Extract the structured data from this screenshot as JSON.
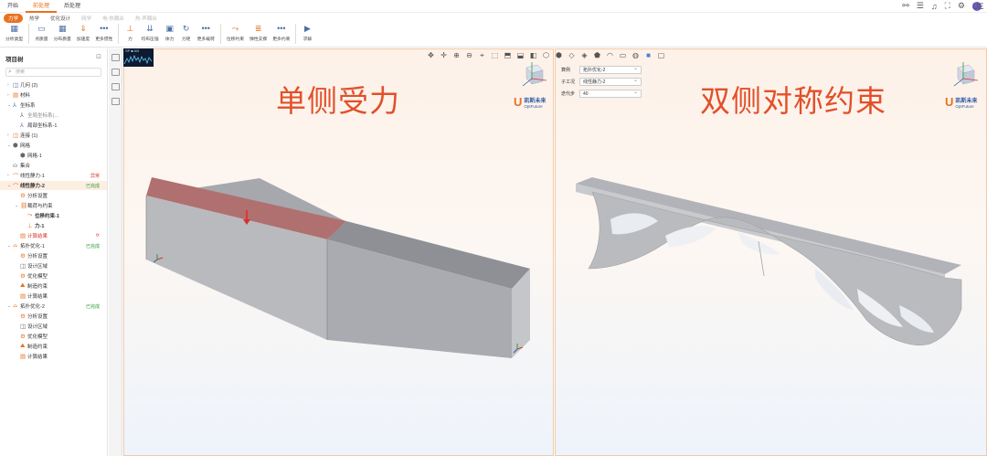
{
  "menu": [
    {
      "label": "开始",
      "active": false
    },
    {
      "label": "前处理",
      "active": true
    },
    {
      "label": "后处理",
      "active": false
    }
  ],
  "subtabs": [
    {
      "label": "力学",
      "state": "active"
    },
    {
      "label": "热学",
      "state": "normal"
    },
    {
      "label": "优化设计",
      "state": "normal"
    },
    {
      "label": "网学",
      "state": "disabled"
    },
    {
      "label": "电-热耦合",
      "state": "disabled"
    },
    {
      "label": "热-声耦合",
      "state": "disabled"
    }
  ],
  "toolbar": [
    {
      "label": "分析类型",
      "icon": "analysis-type-icon",
      "glyph": "▦"
    },
    {
      "sep": true
    },
    {
      "label": "点质量",
      "icon": "point-mass-icon",
      "glyph": "▭"
    },
    {
      "label": "分布质量",
      "icon": "distributed-mass-icon",
      "glyph": "▦"
    },
    {
      "label": "加速度",
      "icon": "acceleration-icon",
      "glyph": "⇓"
    },
    {
      "label": "更多惯性",
      "icon": "more-inertia-icon",
      "glyph": "•••"
    },
    {
      "sep": true
    },
    {
      "label": "力",
      "icon": "force-icon",
      "glyph": "⊥"
    },
    {
      "label": "均布压强",
      "icon": "pressure-icon",
      "glyph": "⇊"
    },
    {
      "label": "体力",
      "icon": "body-force-icon",
      "glyph": "▣"
    },
    {
      "label": "力矩",
      "icon": "moment-icon",
      "glyph": "↻"
    },
    {
      "label": "更多载荷",
      "icon": "more-loads-icon",
      "glyph": "•••"
    },
    {
      "sep": true
    },
    {
      "label": "位移约束",
      "icon": "displacement-icon",
      "glyph": "⤳"
    },
    {
      "label": "弹性支撑",
      "icon": "elastic-support-icon",
      "glyph": "≣"
    },
    {
      "label": "更多约束",
      "icon": "more-constraints-icon",
      "glyph": "•••"
    },
    {
      "sep": true
    },
    {
      "label": "求解",
      "icon": "solve-icon",
      "glyph": "▶"
    }
  ],
  "panel": {
    "title": "项目树",
    "search_placeholder": "搜索"
  },
  "tree": [
    {
      "depth": 0,
      "arrow": "›",
      "icon": "◫",
      "ic": "b",
      "text": "几何 (2)"
    },
    {
      "depth": 0,
      "arrow": "›",
      "icon": "▤",
      "ic": "o",
      "text": "材料"
    },
    {
      "depth": 0,
      "arrow": "⌄",
      "icon": "⅄",
      "ic": "b",
      "text": "坐标系"
    },
    {
      "depth": 1,
      "arrow": "",
      "icon": "⅄",
      "ic": "",
      "text": "全局坐标系(...",
      "style": "grey"
    },
    {
      "depth": 1,
      "arrow": "",
      "icon": "⅄",
      "ic": "b",
      "text": "局部坐标系-1"
    },
    {
      "depth": 0,
      "arrow": "›",
      "icon": "◫",
      "ic": "o",
      "text": "连接 (1)"
    },
    {
      "depth": 0,
      "arrow": "⌄",
      "icon": "⬢",
      "ic": "",
      "text": "网格"
    },
    {
      "depth": 1,
      "arrow": "",
      "icon": "⬢",
      "ic": "",
      "text": "网格-1"
    },
    {
      "depth": 0,
      "arrow": "",
      "icon": "⛀",
      "ic": "",
      "text": "集合"
    },
    {
      "depth": 0,
      "arrow": "›",
      "icon": "⌒",
      "ic": "o",
      "text": "线性静力-1",
      "status": "异常",
      "sc": "red"
    },
    {
      "depth": 0,
      "arrow": "⌄",
      "icon": "⌒",
      "ic": "o",
      "text": "线性静力-2",
      "status": "已完成",
      "sc": "green",
      "style": "bold",
      "sel": true
    },
    {
      "depth": 1,
      "arrow": "",
      "icon": "⚙",
      "ic": "o",
      "text": "分析设置"
    },
    {
      "depth": 1,
      "arrow": "⌄",
      "icon": "⛓",
      "ic": "o",
      "text": "载荷与约束"
    },
    {
      "depth": 2,
      "arrow": "",
      "icon": "⤳",
      "ic": "o",
      "text": "位移约束-1",
      "style": "bold"
    },
    {
      "depth": 2,
      "arrow": "",
      "icon": "⊥",
      "ic": "o",
      "text": "力-1",
      "style": "bold"
    },
    {
      "depth": 1,
      "arrow": "",
      "icon": "▤",
      "ic": "o",
      "text": "计算结果",
      "style": "red",
      "status": "⟳",
      "sc": "red"
    },
    {
      "depth": 0,
      "arrow": "⌄",
      "icon": "⌓",
      "ic": "o",
      "text": "拓扑优化-1",
      "status": "已完成",
      "sc": "green"
    },
    {
      "depth": 1,
      "arrow": "",
      "icon": "⚙",
      "ic": "o",
      "text": "分析设置"
    },
    {
      "depth": 1,
      "arrow": "",
      "icon": "◫",
      "ic": "",
      "text": "设计区域"
    },
    {
      "depth": 1,
      "arrow": "",
      "icon": "⚙",
      "ic": "o",
      "text": "优化模型"
    },
    {
      "depth": 1,
      "arrow": "",
      "icon": "⛰",
      "ic": "o",
      "text": "制造约束"
    },
    {
      "depth": 1,
      "arrow": "",
      "icon": "▤",
      "ic": "o",
      "text": "计算结果"
    },
    {
      "depth": 0,
      "arrow": "⌄",
      "icon": "⌓",
      "ic": "o",
      "text": "拓扑优化-2",
      "status": "已完成",
      "sc": "green"
    },
    {
      "depth": 1,
      "arrow": "",
      "icon": "⚙",
      "ic": "o",
      "text": "分析设置"
    },
    {
      "depth": 1,
      "arrow": "",
      "icon": "◫",
      "ic": "",
      "text": "设计区域"
    },
    {
      "depth": 1,
      "arrow": "",
      "icon": "⚙",
      "ic": "o",
      "text": "优化模型"
    },
    {
      "depth": 1,
      "arrow": "",
      "icon": "⛰",
      "ic": "o",
      "text": "制造约束"
    },
    {
      "depth": 1,
      "arrow": "",
      "icon": "▤",
      "ic": "o",
      "text": "计算结果"
    }
  ],
  "left_view": {
    "title": "单侧受力",
    "minimap_label": "SP ■ AB"
  },
  "right_view": {
    "title": "双侧对称约束",
    "props": [
      {
        "label": "算例",
        "value": "拓扑优化-2"
      },
      {
        "label": "子工况",
        "value": "线性静力-2"
      },
      {
        "label": "迭代步",
        "value": "40"
      }
    ]
  },
  "logo": {
    "name": "凯斯未来",
    "sub": "OptFuture"
  },
  "colors": {
    "accent": "#e8711f",
    "title_red": "#e2502a",
    "status_green": "#2a9d3c",
    "status_red": "#d9302c"
  }
}
